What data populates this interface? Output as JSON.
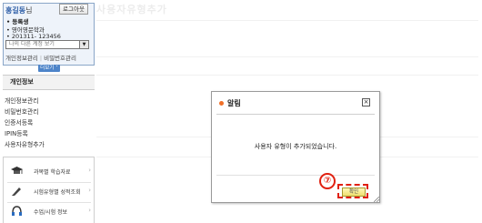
{
  "user": {
    "name": "홍길동",
    "name_suffix": "님",
    "logout_label": "로그아웃",
    "status": "등록생",
    "department": "영어영문학과",
    "student_id": "201311- 123456",
    "account_select_placeholder": "나의 다른 계정 보기"
  },
  "account_links": {
    "profile": "개인정보관리",
    "password": "비밀번호관리"
  },
  "expand_label": "더보기",
  "sidebar": {
    "title": "개인정보",
    "items": [
      {
        "label": "개인정보관리"
      },
      {
        "label": "비밀번호관리"
      },
      {
        "label": "인증서등록"
      },
      {
        "label": "IPIN등록"
      },
      {
        "label": "사용자유형추가"
      }
    ]
  },
  "quick_menu": [
    {
      "label": "과목별 학습자료",
      "icon": "graduation-cap-icon"
    },
    {
      "label": "시험유형별 성적조회",
      "icon": "pen-icon"
    },
    {
      "label": "수업/시험 정보",
      "icon": "headset-icon"
    }
  ],
  "dialog": {
    "title": "알림",
    "message": "사용자 유형이 추가되었습니다.",
    "confirm_label": "확인",
    "step_marker": "⑦"
  },
  "colors": {
    "accent_blue": "#3060a8",
    "dialog_dot": "#f07028",
    "highlight_red": "#e02010"
  }
}
